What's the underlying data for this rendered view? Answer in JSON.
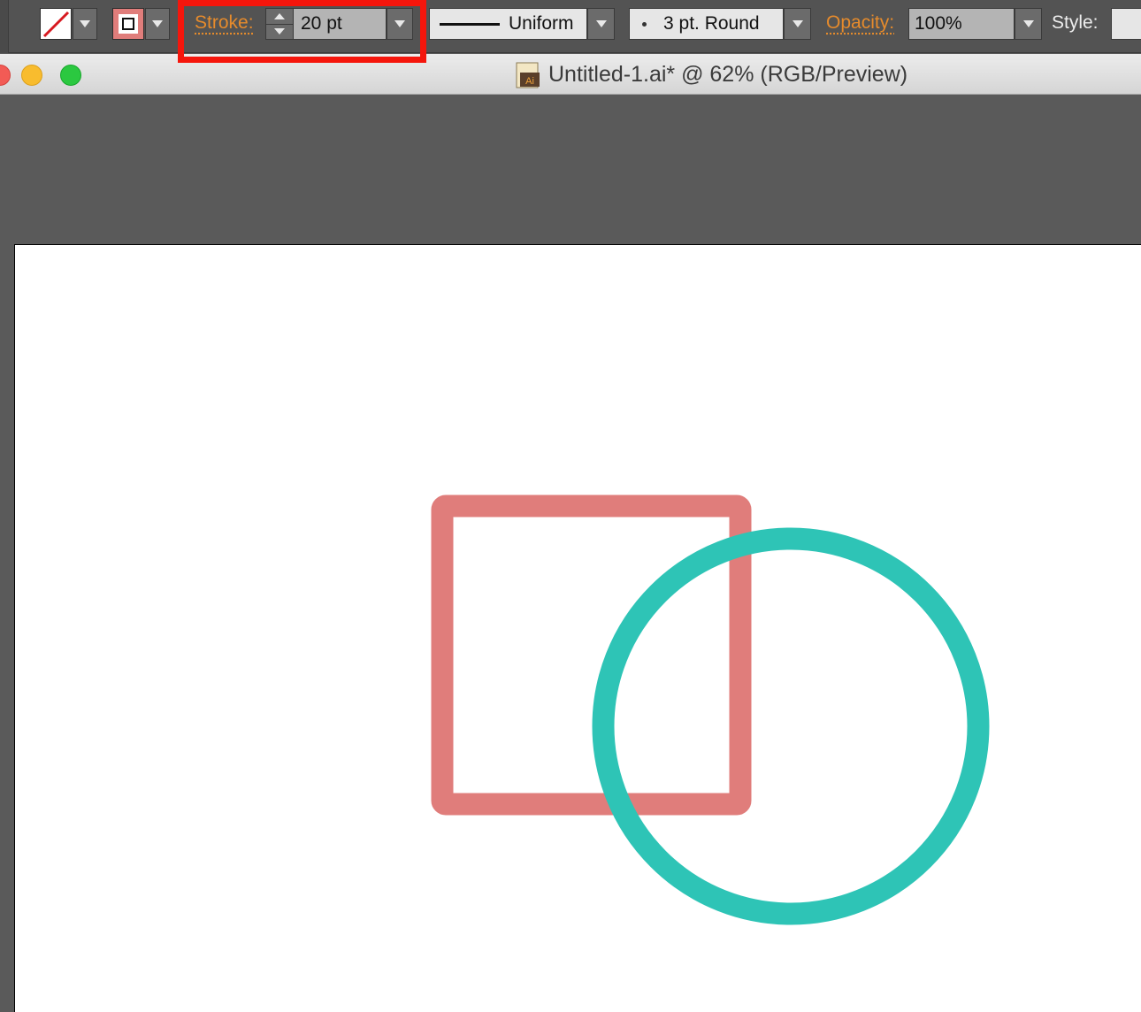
{
  "control_bar": {
    "fill_swatch": {
      "icon": "none-fill-icon"
    },
    "stroke_swatch": {
      "icon": "stroke-swatch-icon",
      "color": "#e07d7b"
    },
    "stroke_label": "Stroke:",
    "stroke_weight": "20 pt",
    "variable_width_profile": "Uniform",
    "brush_definition": "3 pt. Round",
    "opacity_label": "Opacity:",
    "opacity_value": "100%",
    "style_label": "Style:"
  },
  "document": {
    "title": "Untitled-1.ai* @ 62% (RGB/Preview)",
    "file_icon_text": "Ai"
  },
  "artwork": {
    "square_stroke_color": "#e07d7b",
    "circle_stroke_color": "#2ec4b6"
  },
  "colors": {
    "accent_label": "#e68b2c",
    "highlight": "#f5160c"
  }
}
